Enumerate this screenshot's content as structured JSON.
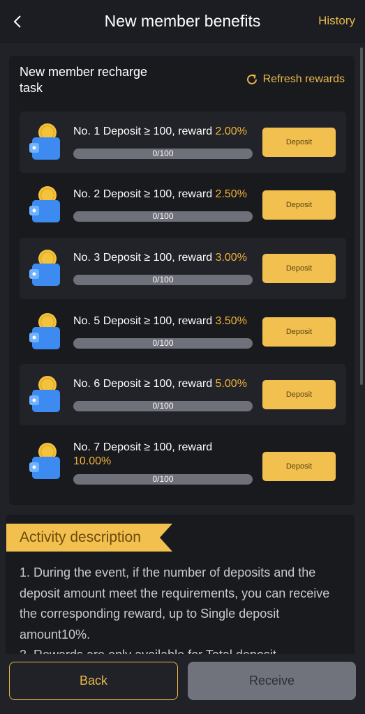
{
  "header": {
    "title": "New member benefits",
    "history_label": "History",
    "back_icon": "chevron-left-icon"
  },
  "task": {
    "title": "New member recharge task",
    "refresh_label": "Refresh rewards",
    "refresh_icon": "refresh-icon",
    "items": [
      {
        "text": "No. 1 Deposit ≥ 100, reward ",
        "percent": "2.00%",
        "progress_label": "0/100",
        "progress_fraction": 0,
        "button": "Deposit"
      },
      {
        "text": "No. 2 Deposit ≥ 100, reward ",
        "percent": "2.50%",
        "progress_label": "0/100",
        "progress_fraction": 0,
        "button": "Deposit"
      },
      {
        "text": "No. 3 Deposit ≥ 100, reward ",
        "percent": "3.00%",
        "progress_label": "0/100",
        "progress_fraction": 0,
        "button": "Deposit"
      },
      {
        "text": "No. 5 Deposit ≥ 100, reward ",
        "percent": "3.50%",
        "progress_label": "0/100",
        "progress_fraction": 0,
        "button": "Deposit"
      },
      {
        "text": "No. 6 Deposit ≥ 100, reward ",
        "percent": "5.00%",
        "progress_label": "0/100",
        "progress_fraction": 0,
        "button": "Deposit"
      },
      {
        "text": "No. 7 Deposit ≥ 100, reward",
        "percent": "10.00%",
        "progress_label": "0/100",
        "progress_fraction": 0,
        "button": "Deposit"
      }
    ]
  },
  "description": {
    "heading": "Activity description",
    "body": "1. During the event, if the number of deposits and the deposit amount meet the requirements, you can receive the corresponding reward, up to Single deposit amount10%.",
    "body_cut": "2. Rewards are only available for Total deposit"
  },
  "footer": {
    "back_label": "Back",
    "receive_label": "Receive"
  },
  "colors": {
    "accent": "#e8b84a",
    "background": "#212228",
    "card": "#191a1e",
    "button": "#f2c04f",
    "disabled": "#70727c"
  }
}
